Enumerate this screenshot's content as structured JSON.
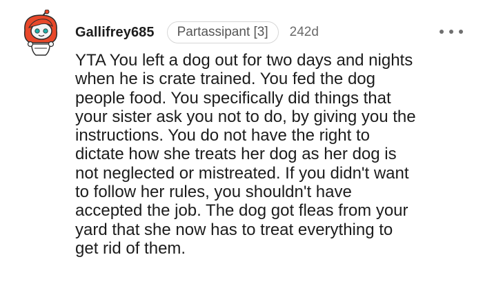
{
  "comment": {
    "username": "Gallifrey685",
    "flair": "Partassipant [3]",
    "age": "242d",
    "more_icon": "more-horizontal-icon",
    "avatar_icon": "snoo-avatar-icon",
    "colors": {
      "avatar_hair": "#e8482a",
      "text": "#1c1c1c",
      "meta": "#6a6a6a"
    },
    "body_lines": [
      "YTA You left a dog out for two days and nights",
      "when he is crate trained. You fed the dog",
      "people food. You specifically did things that",
      "your sister ask you not to do, by giving you the",
      "instructions. You do not have the right to",
      "dictate how she treats her dog as her dog is",
      "not neglected or mistreated. If you didn't want",
      "to follow her rules, you shouldn't have",
      "accepted the job. The dog got fleas from your",
      "yard that she now has to treat everything to",
      "get rid of them."
    ]
  }
}
